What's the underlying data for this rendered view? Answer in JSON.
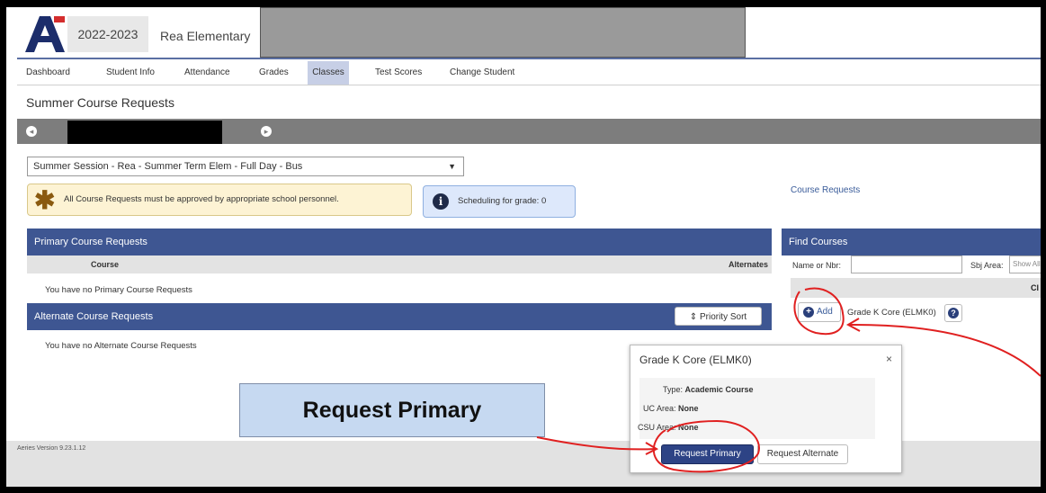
{
  "header": {
    "logo_letter": "A",
    "year": "2022-2023",
    "school": "Rea Elementary"
  },
  "nav": {
    "items": [
      "Dashboard",
      "Student Info",
      "Attendance",
      "Grades",
      "Classes",
      "Test Scores",
      "Change Student"
    ],
    "active": "Classes"
  },
  "page": {
    "title": "Summer Course Requests",
    "session_select": "Summer Session - Rea - Summer Term Elem - Full Day - Bus",
    "notice": "All Course Requests must be approved by appropriate school personnel.",
    "grade_info": "Scheduling for grade: 0",
    "course_requests_link": "Course Requests"
  },
  "primary": {
    "heading": "Primary Course Requests",
    "col_course": "Course",
    "col_alternates": "Alternates",
    "empty": "You have no Primary Course Requests"
  },
  "alternate": {
    "heading": "Alternate Course Requests",
    "priority_sort": "Priority Sort",
    "empty": "You have no Alternate Course Requests"
  },
  "find": {
    "heading": "Find Courses",
    "name_label": "Name or Nbr:",
    "sbj_label": "Sbj Area:",
    "sbj_placeholder": "Show All",
    "col_partial": "Cl",
    "add_label": "Add",
    "result_course": "Grade K Core (ELMK0)"
  },
  "popup": {
    "title": "Grade K Core (ELMK0)",
    "close": "×",
    "type_label": "Type:",
    "type_value": "Academic Course",
    "uc_label": "UC Area:",
    "uc_value": "None",
    "csu_label": "CSU Area:",
    "csu_value": "None",
    "request_primary": "Request Primary",
    "request_alternate": "Request Alternate"
  },
  "footer": {
    "version": "Aeries Version 9.23.1.12"
  },
  "callout": {
    "text": "Request Primary"
  },
  "colors": {
    "panel_blue": "#3e5692",
    "annotation_red": "#e02020",
    "callout_fill": "#c6d9f1"
  }
}
